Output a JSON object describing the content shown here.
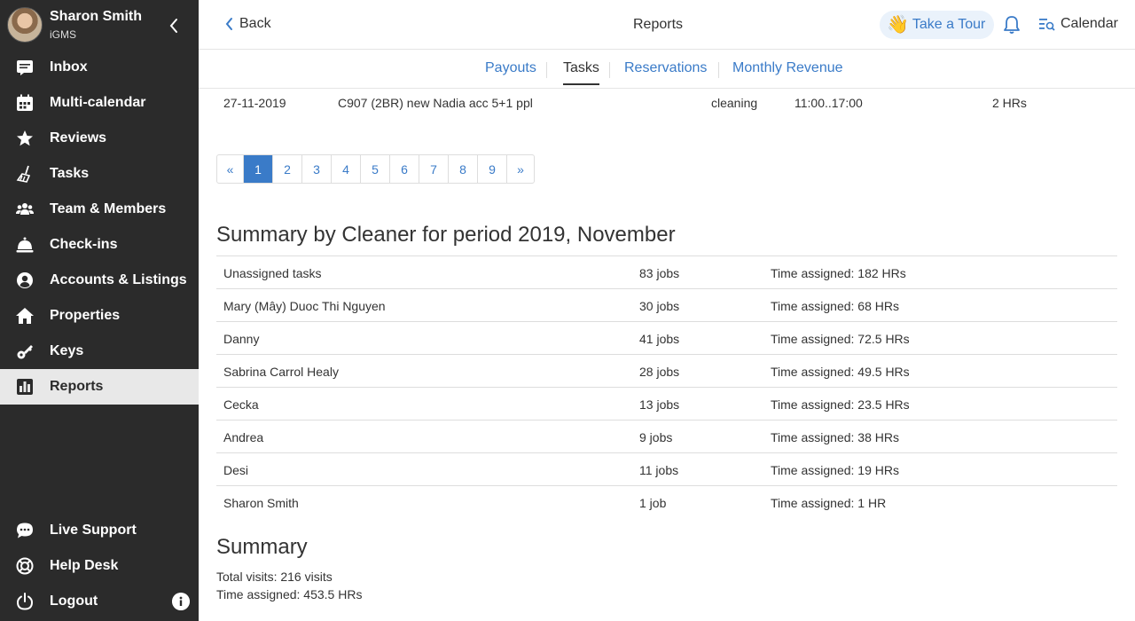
{
  "profile": {
    "name": "Sharon Smith",
    "org": "iGMS"
  },
  "nav": {
    "items": [
      {
        "label": "Inbox",
        "icon": "inbox-icon"
      },
      {
        "label": "Multi-calendar",
        "icon": "calendar-icon"
      },
      {
        "label": "Reviews",
        "icon": "star-icon"
      },
      {
        "label": "Tasks",
        "icon": "broom-icon"
      },
      {
        "label": "Team & Members",
        "icon": "team-icon"
      },
      {
        "label": "Check-ins",
        "icon": "bell-service-icon"
      },
      {
        "label": "Accounts & Listings",
        "icon": "user-circle-icon"
      },
      {
        "label": "Properties",
        "icon": "home-icon"
      },
      {
        "label": "Keys",
        "icon": "key-icon"
      },
      {
        "label": "Reports",
        "icon": "chart-icon",
        "active": true
      }
    ],
    "bottom": [
      {
        "label": "Live Support",
        "icon": "chat-icon"
      },
      {
        "label": "Help Desk",
        "icon": "lifebuoy-icon"
      },
      {
        "label": "Logout",
        "icon": "power-icon"
      }
    ]
  },
  "header": {
    "back_label": "Back",
    "title": "Reports",
    "tour_label": "Take a Tour",
    "tour_emoji": "👋",
    "calendar_label": "Calendar"
  },
  "tabs": [
    {
      "label": "Payouts"
    },
    {
      "label": "Tasks",
      "active": true
    },
    {
      "label": "Reservations"
    },
    {
      "label": "Monthly Revenue"
    }
  ],
  "task_row": {
    "date": "27-11-2019",
    "listing": "C907 (2BR) new Nadia acc 5+1 ppl",
    "type": "cleaning",
    "time": "11:00..17:00",
    "duration": "2 HRs"
  },
  "pagination": {
    "prev": "«",
    "next": "»",
    "pages": [
      "1",
      "2",
      "3",
      "4",
      "5",
      "6",
      "7",
      "8",
      "9"
    ],
    "current": "1"
  },
  "summary_by_cleaner": {
    "title": "Summary by Cleaner for period 2019, November",
    "rows": [
      {
        "name": "Unassigned tasks",
        "jobs": "83 jobs",
        "time": "Time assigned: 182 HRs"
      },
      {
        "name": "Mary (Mây) Duoc Thi Nguyen",
        "jobs": "30 jobs",
        "time": "Time assigned: 68 HRs"
      },
      {
        "name": "Danny",
        "jobs": "41 jobs",
        "time": "Time assigned: 72.5 HRs"
      },
      {
        "name": "Sabrina Carrol Healy",
        "jobs": "28 jobs",
        "time": "Time assigned: 49.5 HRs"
      },
      {
        "name": "Cecka",
        "jobs": "13 jobs",
        "time": "Time assigned: 23.5 HRs"
      },
      {
        "name": "Andrea",
        "jobs": "9 jobs",
        "time": "Time assigned: 38 HRs"
      },
      {
        "name": "Desi",
        "jobs": "11 jobs",
        "time": "Time assigned: 19 HRs"
      },
      {
        "name": "Sharon Smith",
        "jobs": "1 job",
        "time": "Time assigned: 1 HR"
      }
    ]
  },
  "summary": {
    "title": "Summary",
    "total_visits": "Total visits: 216 visits",
    "time_assigned": "Time assigned: 453.5 HRs"
  },
  "colors": {
    "sidebar": "#2b2b2b",
    "accent": "#3a7bc8",
    "active_nav": "#e8e8e8"
  }
}
